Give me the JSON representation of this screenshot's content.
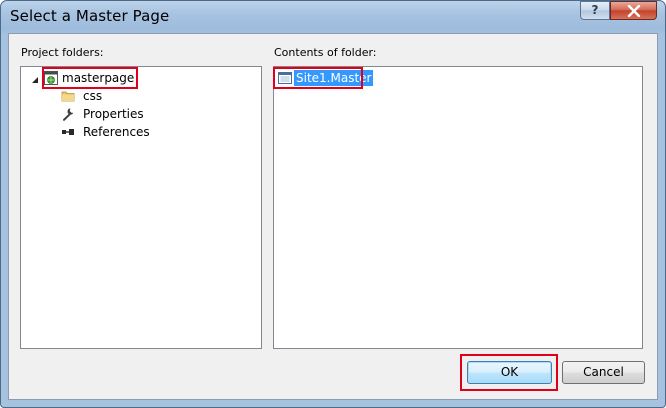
{
  "window": {
    "title": "Select a Master Page",
    "help_label": "?",
    "close_label": "x"
  },
  "left": {
    "label": "Project folders:",
    "tree": [
      {
        "label": "masterpage",
        "icon": "web-project-icon",
        "expanded": true
      },
      {
        "label": "css",
        "icon": "folder-icon"
      },
      {
        "label": "Properties",
        "icon": "wrench-icon"
      },
      {
        "label": "References",
        "icon": "references-icon"
      }
    ]
  },
  "right": {
    "label": "Contents of folder:",
    "files": [
      {
        "label": "Site1.Master",
        "icon": "master-page-icon",
        "selected": true
      }
    ]
  },
  "buttons": {
    "ok_label": "OK",
    "cancel_label": "Cancel"
  },
  "colors": {
    "highlight_border": "#e1001c",
    "selection": "#3399ff"
  }
}
